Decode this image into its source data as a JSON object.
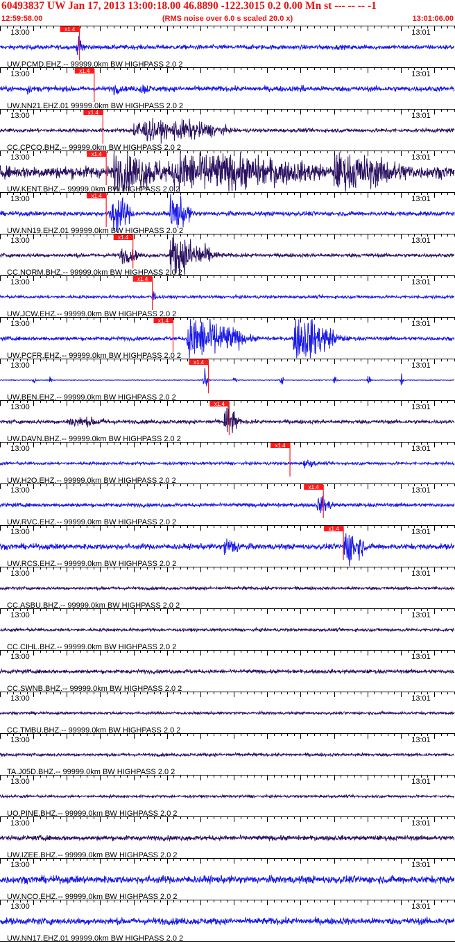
{
  "header": {
    "title": "60493837 UW Jan 17, 2013 13:00:18.00   46.8890 -122.3015  0.2 0.00 Mn st --- -- --  -1",
    "start_time": "12:59:58.00",
    "note": "(RMS noise over 6.0 s scaled 20.0 x)",
    "end_time": "13:01:06.00"
  },
  "colors": {
    "text_red": "#ee1111",
    "pick_red": "#ff1a1a",
    "trace_dark": "#2a1060",
    "trace_blue": "#1a1ae6",
    "axis": "#000000"
  },
  "chart_data": {
    "type": "line",
    "x_unit": "seconds after 12:59:58.00",
    "xlim": [
      0,
      68
    ],
    "tick_labels": [
      {
        "t": 2,
        "label": "13:00"
      },
      {
        "t": 62,
        "label": "13:01"
      }
    ],
    "minor_tick_every_s": 1,
    "major_tick_every_s": 5,
    "pick_label": "x1.4",
    "channels": [
      {
        "label": "UW.PCMD.EHZ.-- 99999.0km BW  HIGHPASS  2.0  2",
        "color": "blue",
        "noise": 0.12,
        "pick": 11.9,
        "bursts": [
          {
            "t": 11.5,
            "amp": 0.45,
            "dur": 1.5
          }
        ]
      },
      {
        "label": "UW.NN21.EHZ.01 99999.0km BW  HIGHPASS  2.0  2",
        "color": "blue",
        "noise": 0.14,
        "pick": 14.1,
        "bursts": [
          {
            "t": 4,
            "amp": 0.3,
            "dur": 0.8
          },
          {
            "t": 17,
            "amp": 0.3,
            "dur": 1.2
          },
          {
            "t": 21,
            "amp": 0.3,
            "dur": 2
          },
          {
            "t": 45,
            "amp": 0.25,
            "dur": 1
          }
        ]
      },
      {
        "label": "CC.CPCO.BHZ.-- 99999.0km BW  HIGHPASS  2.0  2",
        "color": "dark",
        "noise": 0.1,
        "pick": 15.4,
        "bursts": [
          {
            "t": 20,
            "amp": 0.55,
            "dur": 8
          },
          {
            "t": 26,
            "amp": 0.5,
            "dur": 8
          }
        ]
      },
      {
        "label": "UW.KENT.BHZ.-- 99999.0km BW  HIGHPASS  2.0  2",
        "color": "dark",
        "noise": 0.32,
        "pick": 15.9,
        "bursts": [
          {
            "t": 17,
            "amp": 1.0,
            "dur": 9
          },
          {
            "t": 26,
            "amp": 1.0,
            "dur": 22
          },
          {
            "t": 50,
            "amp": 0.9,
            "dur": 12
          }
        ]
      },
      {
        "label": "UW.NN19.EHZ.01 99999.0km BW  HIGHPASS  2.0  2",
        "color": "blue",
        "noise": 0.12,
        "pick": 15.9,
        "bursts": [
          {
            "t": 16.5,
            "amp": 1.0,
            "dur": 3
          },
          {
            "t": 25.5,
            "amp": 0.9,
            "dur": 3
          }
        ]
      },
      {
        "label": "CC.NORM.BHZ.-- 99999.0km BW  HIGHPASS  2.0  2",
        "color": "dark",
        "noise": 0.1,
        "pick": 19.9,
        "bursts": [
          {
            "t": 18,
            "amp": 0.4,
            "dur": 3
          },
          {
            "t": 25.5,
            "amp": 1.0,
            "dur": 6
          }
        ]
      },
      {
        "label": "UW.JCW.EHZ.-- 99999.0km BW  HIGHPASS  2.0  2",
        "color": "blue",
        "noise": 0.08,
        "pick": 22.8,
        "bursts": [
          {
            "t": 22.8,
            "amp": 0.5,
            "dur": 0.5
          }
        ]
      },
      {
        "label": "UW.PCFR.EHZ.-- 99999.0km BW  HIGHPASS  2.0  2",
        "color": "blue",
        "noise": 0.1,
        "pick": 25.9,
        "bursts": [
          {
            "t": 28,
            "amp": 1.1,
            "dur": 8
          },
          {
            "t": 44,
            "amp": 1.1,
            "dur": 6
          }
        ]
      },
      {
        "label": "UW.BEN.EHZ.-- 99999.0km BW  HIGHPASS  2.0  2",
        "color": "blue",
        "noise": 0.02,
        "pick": 31.2,
        "bursts": [
          {
            "t": 5,
            "amp": 0.3,
            "dur": 0.3
          },
          {
            "t": 7.5,
            "amp": 0.3,
            "dur": 0.3
          },
          {
            "t": 30.5,
            "amp": 0.7,
            "dur": 0.6
          },
          {
            "t": 35,
            "amp": 0.35,
            "dur": 0.4
          },
          {
            "t": 42,
            "amp": 0.3,
            "dur": 0.4
          },
          {
            "t": 50,
            "amp": 0.35,
            "dur": 0.4
          },
          {
            "t": 55,
            "amp": 0.3,
            "dur": 0.5
          },
          {
            "t": 60,
            "amp": 0.3,
            "dur": 0.4
          }
        ]
      },
      {
        "label": "UW.DAVN.BHZ.-- 99999.0km BW  HIGHPASS  2.0  2",
        "color": "dark",
        "noise": 0.1,
        "pick": 34.3,
        "bursts": [
          {
            "t": 10,
            "amp": 0.25,
            "dur": 8
          },
          {
            "t": 33.6,
            "amp": 0.85,
            "dur": 2
          }
        ]
      },
      {
        "label": "UW.H2O.EHZ.-- 99999.0km BW  HIGHPASS  2.0  2",
        "color": "blue",
        "noise": 0.08,
        "pick": 43.4,
        "bursts": [
          {
            "t": 45.5,
            "amp": 0.22,
            "dur": 2
          }
        ]
      },
      {
        "label": "UW.RVC.EHZ.-- 99999.0km BW  HIGHPASS  2.0  2",
        "color": "blue",
        "noise": 0.1,
        "pick": 48.4,
        "bursts": [
          {
            "t": 47.5,
            "amp": 0.4,
            "dur": 2.5
          }
        ]
      },
      {
        "label": "UW.RCS.EHZ.-- 99999.0km BW  HIGHPASS  2.0  2",
        "color": "blue",
        "noise": 0.15,
        "pick": 51.4,
        "bursts": [
          {
            "t": 33.5,
            "amp": 0.45,
            "dur": 3
          },
          {
            "t": 51.5,
            "amp": 0.95,
            "dur": 3
          }
        ]
      },
      {
        "label": "CC.ASBU.BHZ.-- 99999.0km BW  HIGHPASS  2.0  2",
        "color": "dark",
        "noise": 0.08,
        "pick": null,
        "bursts": []
      },
      {
        "label": "CC.CIHL.BHZ.-- 99999.0km BW  HIGHPASS  2.0  2",
        "color": "dark",
        "noise": 0.08,
        "pick": null,
        "bursts": []
      },
      {
        "label": "CC.SWNB.BHZ.-- 99999.0km BW  HIGHPASS  2.0  2",
        "color": "dark",
        "noise": 0.1,
        "pick": null,
        "bursts": []
      },
      {
        "label": "CC.TMBU.BHZ.-- 99999.0km BW  HIGHPASS  2.0  2",
        "color": "dark",
        "noise": 0.07,
        "pick": null,
        "bursts": []
      },
      {
        "label": "TA.J05D.BHZ.-- 99999.0km BW  HIGHPASS  2.0  2",
        "color": "dark",
        "noise": 0.08,
        "pick": null,
        "bursts": []
      },
      {
        "label": "UO.PINE.BHZ.-- 99999.0km BW  HIGHPASS  2.0  2",
        "color": "dark",
        "noise": 0.07,
        "pick": null,
        "bursts": []
      },
      {
        "label": "UW.IZEE.BHZ.-- 99999.0km BW  HIGHPASS  2.0  2",
        "color": "dark",
        "noise": 0.13,
        "pick": null,
        "bursts": []
      },
      {
        "label": "UW.NCO.EHZ.-- 99999.0km BW  HIGHPASS  2.0  2",
        "color": "blue",
        "noise": 0.2,
        "pick": null,
        "bursts": []
      },
      {
        "label": "UW.NN17.EHZ.01 99999.0km BW  HIGHPASS  2.0  2",
        "color": "blue",
        "noise": 0.18,
        "pick": null,
        "bursts": []
      }
    ]
  }
}
